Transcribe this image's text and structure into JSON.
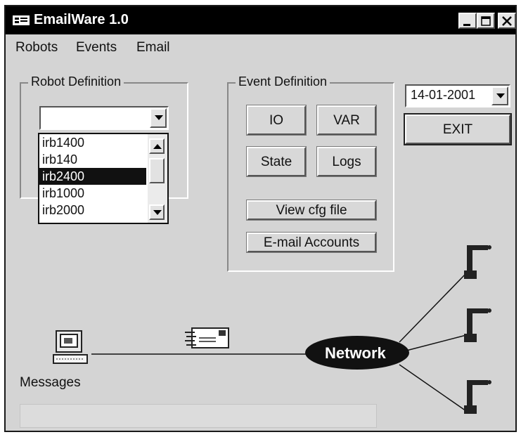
{
  "window": {
    "title": "EmailWare 1.0"
  },
  "menu": [
    "Robots",
    "Events",
    "Email"
  ],
  "robot_definition": {
    "group_label": "Robot Definition",
    "combo_value": "",
    "list_items": [
      "irb1400",
      "irb140",
      "irb2400",
      "irb1000",
      "irb2000"
    ],
    "selected": "irb2400"
  },
  "event_definition": {
    "group_label": "Event Definition",
    "buttons": {
      "io": "IO",
      "var": "VAR",
      "state": "State",
      "logs": "Logs",
      "view_cfg": "View cfg file",
      "email_accounts": "E-mail Accounts"
    }
  },
  "date_combo": {
    "value": "14-01-2001"
  },
  "exit_button": "EXIT",
  "diagram": {
    "network_label": "Network",
    "messages_label": "Messages"
  },
  "colors": {
    "titlebar": "#000000",
    "window_bg": "#d4d4d4",
    "network_node": "#111111"
  },
  "icons": [
    "app-icon",
    "minimize-icon",
    "maximize-icon",
    "close-icon",
    "computer-icon",
    "email-envelope-icon",
    "robot-arm-icon"
  ]
}
